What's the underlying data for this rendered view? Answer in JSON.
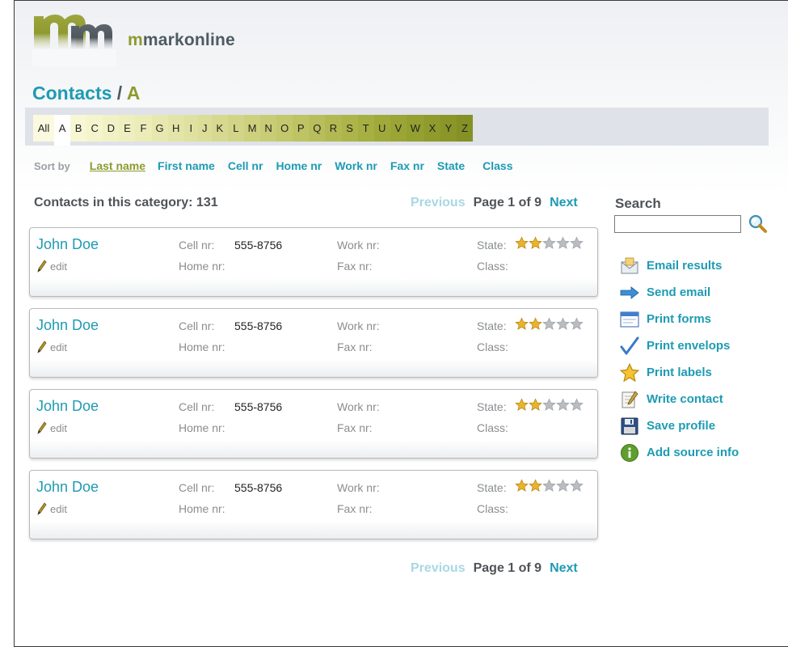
{
  "brand": {
    "prefix": "m",
    "rest": "markonline"
  },
  "title": {
    "main": "Contacts",
    "separator": "/",
    "letter": "A"
  },
  "alphabet": [
    {
      "label": "All",
      "bg": "#fbfadf"
    },
    {
      "label": "A",
      "bg": "#ffffff",
      "active": true
    },
    {
      "label": "B",
      "bg": "#f7f7d4"
    },
    {
      "label": "C",
      "bg": "#f4f4cd"
    },
    {
      "label": "D",
      "bg": "#f1f1c6"
    },
    {
      "label": "E",
      "bg": "#eeefbf"
    },
    {
      "label": "F",
      "bg": "#ebecb8"
    },
    {
      "label": "G",
      "bg": "#e7e8b0"
    },
    {
      "label": "H",
      "bg": "#e3e5a8"
    },
    {
      "label": "I",
      "bg": "#dfe1a0"
    },
    {
      "label": "J",
      "bg": "#dbdd98"
    },
    {
      "label": "K",
      "bg": "#d6d98f"
    },
    {
      "label": "L",
      "bg": "#d2d587"
    },
    {
      "label": "M",
      "bg": "#cdd17e"
    },
    {
      "label": "N",
      "bg": "#c8cc76"
    },
    {
      "label": "O",
      "bg": "#c3c86d"
    },
    {
      "label": "P",
      "bg": "#bec364"
    },
    {
      "label": "Q",
      "bg": "#b8be5b"
    },
    {
      "label": "R",
      "bg": "#b2b952"
    },
    {
      "label": "S",
      "bg": "#acb44a"
    },
    {
      "label": "T",
      "bg": "#a6af42"
    },
    {
      "label": "U",
      "bg": "#a0aa3b"
    },
    {
      "label": "V",
      "bg": "#9aa535"
    },
    {
      "label": "W",
      "bg": "#94a030"
    },
    {
      "label": "X",
      "bg": "#8f9b2c"
    },
    {
      "label": "Y",
      "bg": "#8a9628"
    },
    {
      "label": "Z",
      "bg": "#859125"
    }
  ],
  "sort": {
    "label": "Sort by",
    "options": [
      "Last name",
      "First name",
      "Cell nr",
      "Home nr",
      "Work nr",
      "Fax nr",
      "State",
      "Class"
    ],
    "selected": "Last name"
  },
  "count_text": "Contacts in this category: 131",
  "pager": {
    "previous": "Previous",
    "info": "Page 1 of 9",
    "next": "Next"
  },
  "labels": {
    "edit": "edit",
    "cell": "Cell nr:",
    "home": "Home nr:",
    "work": "Work nr:",
    "fax": "Fax nr:",
    "state": "State:",
    "class": "Class:"
  },
  "contacts": [
    {
      "name": "John Doe",
      "cell": "555-8756",
      "home": "",
      "work": "",
      "fax": "",
      "rating": 2,
      "rating_max": 5,
      "class": ""
    },
    {
      "name": "John Doe",
      "cell": "555-8756",
      "home": "",
      "work": "",
      "fax": "",
      "rating": 2,
      "rating_max": 5,
      "class": ""
    },
    {
      "name": "John Doe",
      "cell": "555-8756",
      "home": "",
      "work": "",
      "fax": "",
      "rating": 2,
      "rating_max": 5,
      "class": ""
    },
    {
      "name": "John Doe",
      "cell": "555-8756",
      "home": "",
      "work": "",
      "fax": "",
      "rating": 2,
      "rating_max": 5,
      "class": ""
    }
  ],
  "search": {
    "title": "Search",
    "value": "",
    "placeholder": ""
  },
  "actions": [
    {
      "label": "Email results",
      "icon": "envelope-icon"
    },
    {
      "label": "Send email",
      "icon": "arrow-right-icon"
    },
    {
      "label": "Print forms",
      "icon": "form-window-icon"
    },
    {
      "label": "Print envelops",
      "icon": "checkmark-icon"
    },
    {
      "label": "Print labels",
      "icon": "star-icon"
    },
    {
      "label": "Write contact",
      "icon": "notepad-pencil-icon"
    },
    {
      "label": "Save profile",
      "icon": "floppy-disk-icon"
    },
    {
      "label": "Add source info",
      "icon": "info-icon"
    }
  ],
  "colors": {
    "accent": "#1d9bb3",
    "brand_green": "#8d9b2e",
    "star_gold": "#e8b52a",
    "star_gray": "#b9bcc0"
  }
}
